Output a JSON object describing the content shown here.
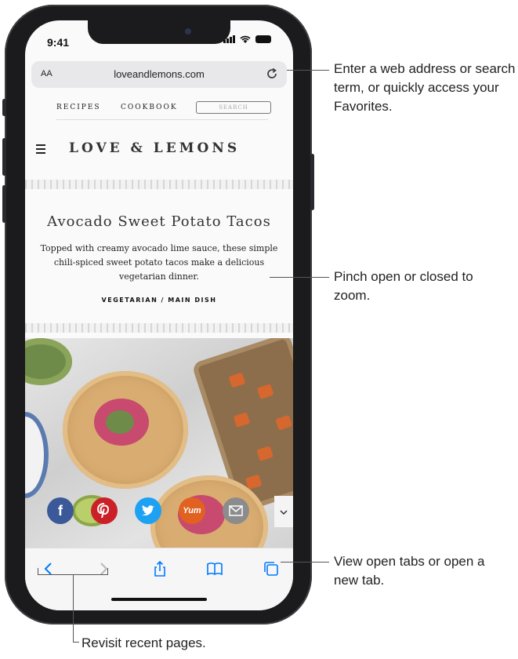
{
  "status_bar": {
    "time": "9:41"
  },
  "address_bar": {
    "text_size_label": "AA",
    "url": "loveandlemons.com"
  },
  "site_nav": {
    "links": [
      "RECIPES",
      "COOKBOOK"
    ],
    "search_placeholder": "SEARCH"
  },
  "site": {
    "logo": "LOVE & LEMONS"
  },
  "article": {
    "title": "Avocado Sweet Potato Tacos",
    "description": "Topped with creamy avocado lime sauce, these simple chili-spiced sweet potato tacos make a delicious vegetarian dinner.",
    "category": "VEGETARIAN / MAIN DISH"
  },
  "share": {
    "facebook_label": "f",
    "yum_label": "Yum",
    "colors": {
      "facebook": "#3b5998",
      "pinterest": "#cb2027",
      "twitter": "#1da1f2",
      "yummly": "#e16120",
      "email": "#8c8c8c"
    }
  },
  "toolbar": {
    "icons": [
      "back-icon",
      "forward-icon",
      "share-icon",
      "bookmarks-icon",
      "tabs-icon"
    ],
    "accent": "#007aff"
  },
  "callouts": {
    "address": "Enter a web address or search term, or quickly access your Favorites.",
    "zoom": "Pinch open or closed to zoom.",
    "tabs": "View open tabs or open a new tab.",
    "back_forward": "Revisit recent pages."
  }
}
